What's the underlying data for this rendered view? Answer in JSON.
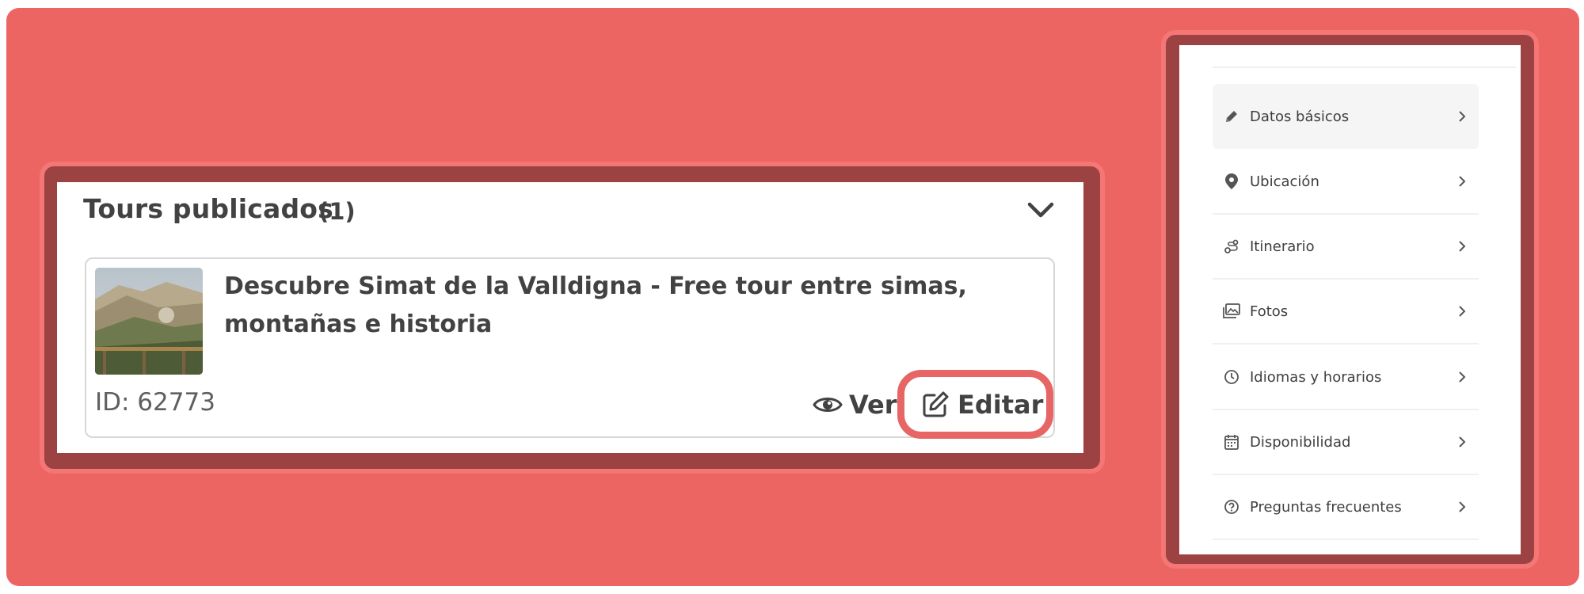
{
  "published_tours": {
    "title": "Tours publicados",
    "count": "(1)",
    "tour": {
      "title": "Descubre Simat de la Valldigna - Free tour entre simas, montañas e historia",
      "id_label": "ID: 62773",
      "view_label": "Ver",
      "edit_label": "Editar"
    }
  },
  "menu": {
    "items": [
      {
        "label": "Datos básicos",
        "icon": "pencil-icon",
        "active": true
      },
      {
        "label": "Ubicación",
        "icon": "location-pin-icon"
      },
      {
        "label": "Itinerario",
        "icon": "route-icon"
      },
      {
        "label": "Fotos",
        "icon": "photos-icon"
      },
      {
        "label": "Idiomas y horarios",
        "icon": "clock-icon"
      },
      {
        "label": "Disponibilidad",
        "icon": "calendar-icon"
      },
      {
        "label": "Preguntas frecuentes",
        "icon": "question-circle-icon"
      }
    ]
  },
  "colors": {
    "overlay": "#ec6563",
    "frame": "#9d4242",
    "text": "#424242"
  }
}
